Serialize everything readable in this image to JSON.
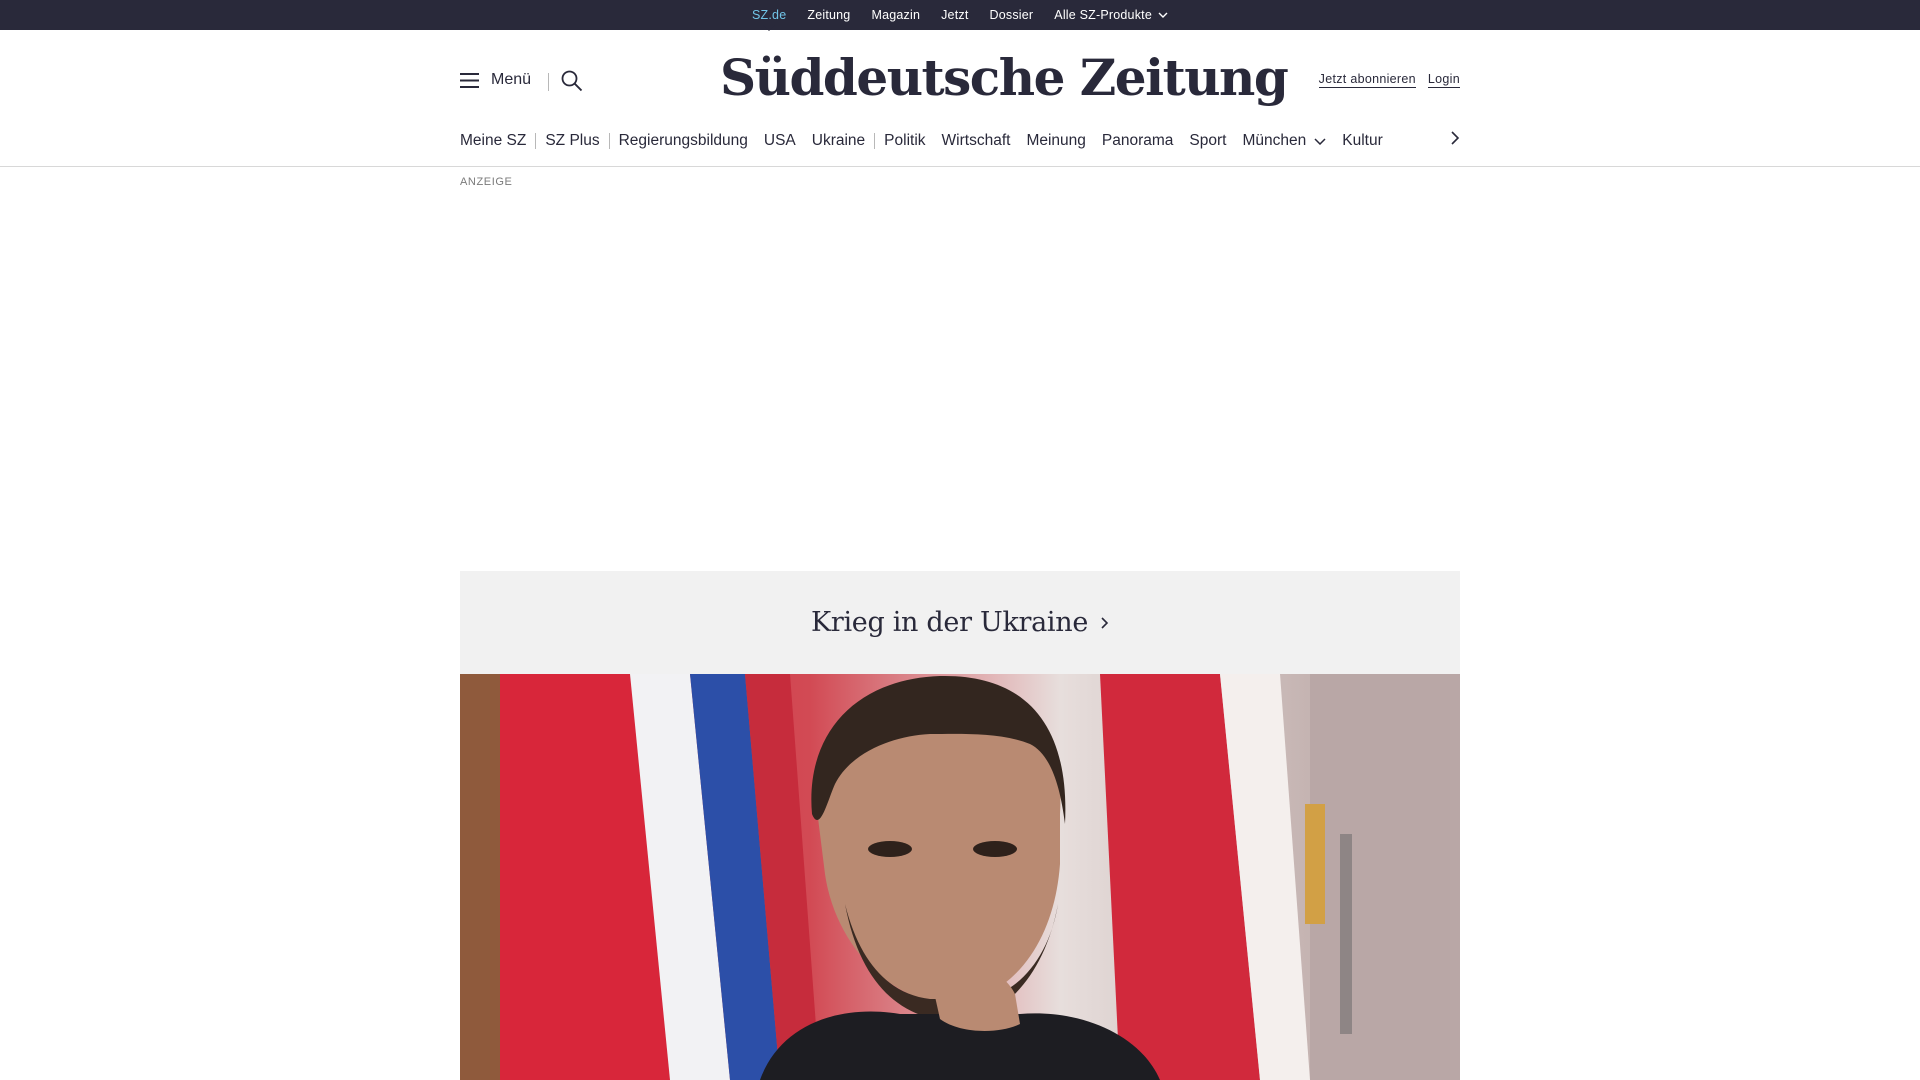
{
  "top_bar": {
    "items": [
      {
        "label": "SZ.de"
      },
      {
        "label": "Zeitung"
      },
      {
        "label": "Magazin"
      },
      {
        "label": "Jetzt"
      },
      {
        "label": "Dossier"
      },
      {
        "label": "Alle SZ-Produkte"
      }
    ],
    "active_color": "#71c5e8",
    "background": "#29293a"
  },
  "header": {
    "menu_label": "Menü",
    "logo_text": "Süddeutsche Zeitung",
    "subscribe_label": "Jetzt abonnieren",
    "login_label": "Login"
  },
  "nav": {
    "items": [
      {
        "label": "Meine SZ"
      },
      {
        "label": "SZ Plus"
      },
      {
        "label": "Regierungsbildung"
      },
      {
        "label": "USA"
      },
      {
        "label": "Ukraine"
      },
      {
        "label": "Politik"
      },
      {
        "label": "Wirtschaft"
      },
      {
        "label": "Meinung"
      },
      {
        "label": "Panorama"
      },
      {
        "label": "Sport"
      },
      {
        "label": "München"
      },
      {
        "label": "Kultur"
      }
    ]
  },
  "ad": {
    "label": "ANZEIGE"
  },
  "teaser": {
    "title": "Krieg in der Ukraine"
  },
  "colors": {
    "brand_dark": "#29293a",
    "band_bg": "#f1f1f1"
  }
}
